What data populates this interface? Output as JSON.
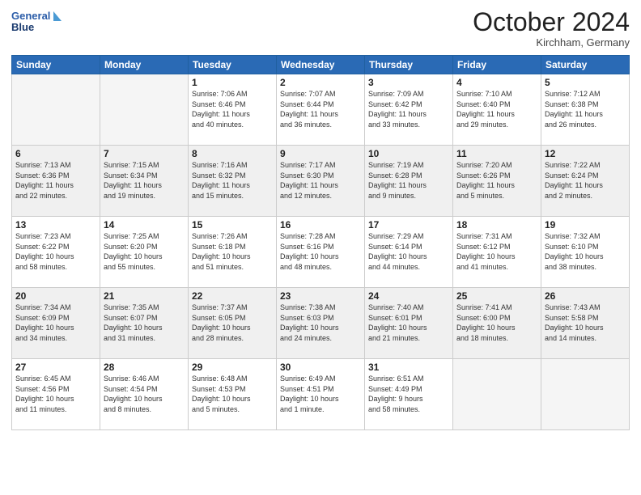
{
  "header": {
    "logo_line1": "General",
    "logo_line2": "Blue",
    "month": "October 2024",
    "location": "Kirchham, Germany"
  },
  "weekdays": [
    "Sunday",
    "Monday",
    "Tuesday",
    "Wednesday",
    "Thursday",
    "Friday",
    "Saturday"
  ],
  "weeks": [
    [
      {
        "day": "",
        "info": ""
      },
      {
        "day": "",
        "info": ""
      },
      {
        "day": "1",
        "info": "Sunrise: 7:06 AM\nSunset: 6:46 PM\nDaylight: 11 hours\nand 40 minutes."
      },
      {
        "day": "2",
        "info": "Sunrise: 7:07 AM\nSunset: 6:44 PM\nDaylight: 11 hours\nand 36 minutes."
      },
      {
        "day": "3",
        "info": "Sunrise: 7:09 AM\nSunset: 6:42 PM\nDaylight: 11 hours\nand 33 minutes."
      },
      {
        "day": "4",
        "info": "Sunrise: 7:10 AM\nSunset: 6:40 PM\nDaylight: 11 hours\nand 29 minutes."
      },
      {
        "day": "5",
        "info": "Sunrise: 7:12 AM\nSunset: 6:38 PM\nDaylight: 11 hours\nand 26 minutes."
      }
    ],
    [
      {
        "day": "6",
        "info": "Sunrise: 7:13 AM\nSunset: 6:36 PM\nDaylight: 11 hours\nand 22 minutes."
      },
      {
        "day": "7",
        "info": "Sunrise: 7:15 AM\nSunset: 6:34 PM\nDaylight: 11 hours\nand 19 minutes."
      },
      {
        "day": "8",
        "info": "Sunrise: 7:16 AM\nSunset: 6:32 PM\nDaylight: 11 hours\nand 15 minutes."
      },
      {
        "day": "9",
        "info": "Sunrise: 7:17 AM\nSunset: 6:30 PM\nDaylight: 11 hours\nand 12 minutes."
      },
      {
        "day": "10",
        "info": "Sunrise: 7:19 AM\nSunset: 6:28 PM\nDaylight: 11 hours\nand 9 minutes."
      },
      {
        "day": "11",
        "info": "Sunrise: 7:20 AM\nSunset: 6:26 PM\nDaylight: 11 hours\nand 5 minutes."
      },
      {
        "day": "12",
        "info": "Sunrise: 7:22 AM\nSunset: 6:24 PM\nDaylight: 11 hours\nand 2 minutes."
      }
    ],
    [
      {
        "day": "13",
        "info": "Sunrise: 7:23 AM\nSunset: 6:22 PM\nDaylight: 10 hours\nand 58 minutes."
      },
      {
        "day": "14",
        "info": "Sunrise: 7:25 AM\nSunset: 6:20 PM\nDaylight: 10 hours\nand 55 minutes."
      },
      {
        "day": "15",
        "info": "Sunrise: 7:26 AM\nSunset: 6:18 PM\nDaylight: 10 hours\nand 51 minutes."
      },
      {
        "day": "16",
        "info": "Sunrise: 7:28 AM\nSunset: 6:16 PM\nDaylight: 10 hours\nand 48 minutes."
      },
      {
        "day": "17",
        "info": "Sunrise: 7:29 AM\nSunset: 6:14 PM\nDaylight: 10 hours\nand 44 minutes."
      },
      {
        "day": "18",
        "info": "Sunrise: 7:31 AM\nSunset: 6:12 PM\nDaylight: 10 hours\nand 41 minutes."
      },
      {
        "day": "19",
        "info": "Sunrise: 7:32 AM\nSunset: 6:10 PM\nDaylight: 10 hours\nand 38 minutes."
      }
    ],
    [
      {
        "day": "20",
        "info": "Sunrise: 7:34 AM\nSunset: 6:09 PM\nDaylight: 10 hours\nand 34 minutes."
      },
      {
        "day": "21",
        "info": "Sunrise: 7:35 AM\nSunset: 6:07 PM\nDaylight: 10 hours\nand 31 minutes."
      },
      {
        "day": "22",
        "info": "Sunrise: 7:37 AM\nSunset: 6:05 PM\nDaylight: 10 hours\nand 28 minutes."
      },
      {
        "day": "23",
        "info": "Sunrise: 7:38 AM\nSunset: 6:03 PM\nDaylight: 10 hours\nand 24 minutes."
      },
      {
        "day": "24",
        "info": "Sunrise: 7:40 AM\nSunset: 6:01 PM\nDaylight: 10 hours\nand 21 minutes."
      },
      {
        "day": "25",
        "info": "Sunrise: 7:41 AM\nSunset: 6:00 PM\nDaylight: 10 hours\nand 18 minutes."
      },
      {
        "day": "26",
        "info": "Sunrise: 7:43 AM\nSunset: 5:58 PM\nDaylight: 10 hours\nand 14 minutes."
      }
    ],
    [
      {
        "day": "27",
        "info": "Sunrise: 6:45 AM\nSunset: 4:56 PM\nDaylight: 10 hours\nand 11 minutes."
      },
      {
        "day": "28",
        "info": "Sunrise: 6:46 AM\nSunset: 4:54 PM\nDaylight: 10 hours\nand 8 minutes."
      },
      {
        "day": "29",
        "info": "Sunrise: 6:48 AM\nSunset: 4:53 PM\nDaylight: 10 hours\nand 5 minutes."
      },
      {
        "day": "30",
        "info": "Sunrise: 6:49 AM\nSunset: 4:51 PM\nDaylight: 10 hours\nand 1 minute."
      },
      {
        "day": "31",
        "info": "Sunrise: 6:51 AM\nSunset: 4:49 PM\nDaylight: 9 hours\nand 58 minutes."
      },
      {
        "day": "",
        "info": ""
      },
      {
        "day": "",
        "info": ""
      }
    ]
  ]
}
